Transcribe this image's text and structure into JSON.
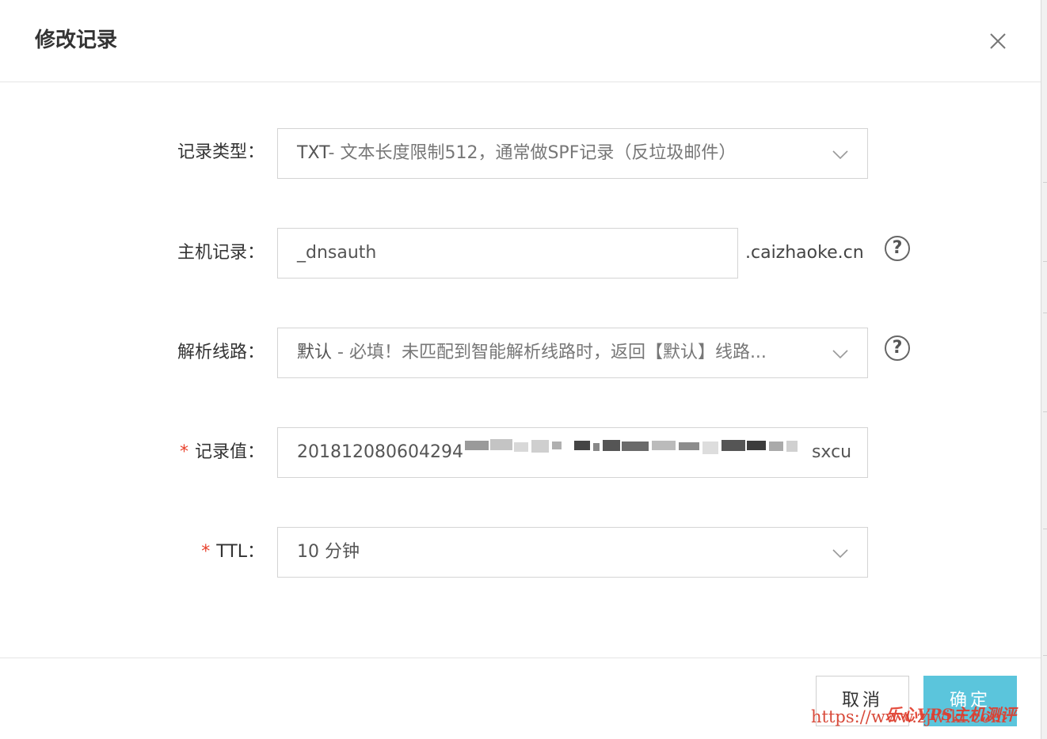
{
  "dialog": {
    "title": "修改记录",
    "close_icon": "close-icon"
  },
  "form": {
    "record_type": {
      "label": "记录类型：",
      "value": "TXT",
      "hint": "- 文本长度限制512，通常做SPF记录（反垃圾邮件）"
    },
    "host_record": {
      "label": "主机记录：",
      "value": "_dnsauth",
      "suffix": ".caizhaoke.cn",
      "help_icon": "question-circle-icon"
    },
    "line": {
      "label": "解析线路：",
      "value": "默认",
      "hint": " - 必填！未匹配到智能解析线路时，返回【默认】线路...",
      "help_icon": "question-circle-icon"
    },
    "record_value": {
      "required_mark": "*",
      "label": "记录值：",
      "value_prefix": "201812080604294",
      "value_tail": "sxcu"
    },
    "ttl": {
      "required_mark": "*",
      "label": "TTL：",
      "value": "10 分钟"
    }
  },
  "footer": {
    "cancel_label": "取消",
    "ok_label": "确定"
  },
  "watermark": {
    "site_name": "乐心VPS主机测评",
    "url": "https://www.zjwiki.com"
  },
  "colors": {
    "primary": "#5bc5dc",
    "required": "#e8412c",
    "border": "#d4d4d4",
    "watermark": "#e23a2a"
  }
}
